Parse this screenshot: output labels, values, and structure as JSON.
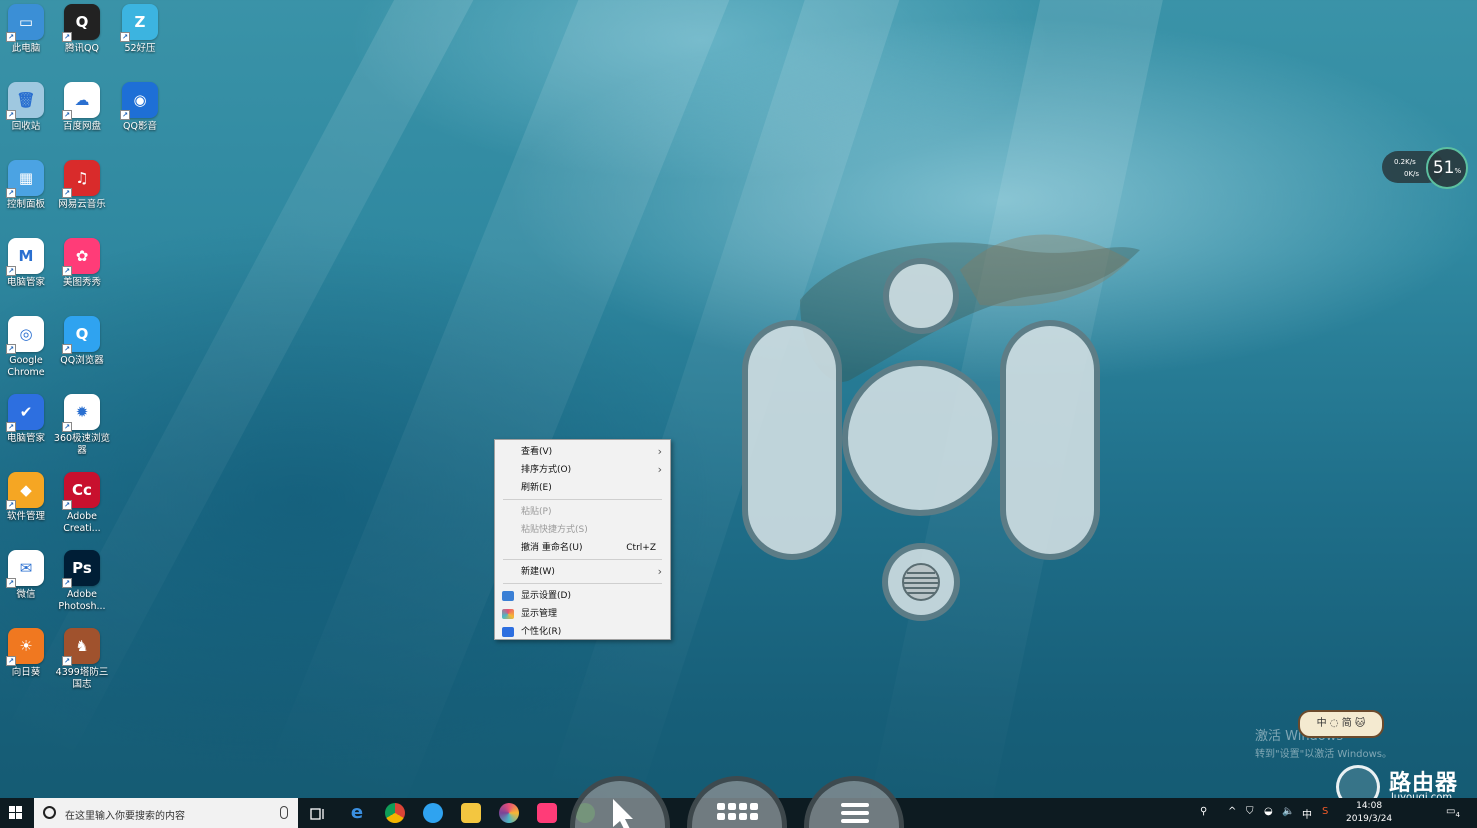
{
  "desktop": {
    "icons": [
      {
        "label": "此电脑",
        "color": "#3b8fd6",
        "glyph": "▭"
      },
      {
        "label": "腾讯QQ",
        "color": "#222222",
        "glyph": "Q"
      },
      {
        "label": "52好压",
        "color": "#3cb4e0",
        "glyph": "Z"
      },
      {
        "label": "回收站",
        "color": "#9fc8e0",
        "glyph": "🗑"
      },
      {
        "label": "百度网盘",
        "color": "#ffffff",
        "glyph": "☁"
      },
      {
        "label": "QQ影音",
        "color": "#1e6fd6",
        "glyph": "◉"
      },
      {
        "label": "控制面板",
        "color": "#4ba3e3",
        "glyph": "▦"
      },
      {
        "label": "网易云音乐",
        "color": "#d92b2b",
        "glyph": "♫"
      },
      {
        "label": "电脑管家",
        "color": "#ffffff",
        "glyph": "M"
      },
      {
        "label": "美图秀秀",
        "color": "#ff3c78",
        "glyph": "✿"
      },
      {
        "label": "Google Chrome",
        "color": "#ffffff",
        "glyph": "◎"
      },
      {
        "label": "QQ浏览器",
        "color": "#2fa3f0",
        "glyph": "Q"
      },
      {
        "label": "电脑管家",
        "color": "#2d6fe0",
        "glyph": "✔"
      },
      {
        "label": "360极速浏览器",
        "color": "#ffffff",
        "glyph": "✹"
      },
      {
        "label": "软件管理",
        "color": "#f5a623",
        "glyph": "◆"
      },
      {
        "label": "Adobe Creati...",
        "color": "#c8102e",
        "glyph": "Cc"
      },
      {
        "label": "微信",
        "color": "#ffffff",
        "glyph": "✉"
      },
      {
        "label": "Adobe Photosh...",
        "color": "#001e36",
        "glyph": "Ps"
      },
      {
        "label": "向日葵",
        "color": "#f07820",
        "glyph": "☀"
      },
      {
        "label": "4399塔防三国志",
        "color": "#a0522d",
        "glyph": "♞"
      }
    ]
  },
  "context_menu": {
    "items": [
      {
        "label": "查看(V)",
        "shortcut": "",
        "submenu": true,
        "disabled": false
      },
      {
        "label": "排序方式(O)",
        "shortcut": "",
        "submenu": true,
        "disabled": false
      },
      {
        "label": "刷新(E)",
        "shortcut": "",
        "submenu": false,
        "disabled": false
      },
      {
        "separator": true
      },
      {
        "label": "粘贴(P)",
        "shortcut": "",
        "submenu": false,
        "disabled": true
      },
      {
        "label": "粘贴快捷方式(S)",
        "shortcut": "",
        "submenu": false,
        "disabled": true
      },
      {
        "label": "撤消 重命名(U)",
        "shortcut": "Ctrl+Z",
        "submenu": false,
        "disabled": false
      },
      {
        "separator": true
      },
      {
        "label": "新建(W)",
        "shortcut": "",
        "submenu": true,
        "disabled": false
      },
      {
        "separator": true
      },
      {
        "label": "显示设置(D)",
        "shortcut": "",
        "submenu": false,
        "disabled": false,
        "icon": "display-icon"
      },
      {
        "label": "显示管理",
        "shortcut": "",
        "submenu": false,
        "disabled": false,
        "icon": "color-wheel-icon"
      },
      {
        "label": "个性化(R)",
        "shortcut": "",
        "submenu": false,
        "disabled": false,
        "icon": "personalize-icon"
      }
    ]
  },
  "net_meter": {
    "up": "0.2K/s",
    "down": "0K/s",
    "percent": "51",
    "unit": "%"
  },
  "watermark": {
    "line1": "激活 Windows",
    "line2": "转到\"设置\"以激活 Windows。"
  },
  "sticker": {
    "text": "中 ◌ 简 🐱"
  },
  "brand": {
    "name": "路由器",
    "url": "luyouqi.com"
  },
  "taskbar": {
    "search_placeholder": "在这里输入你要搜索的内容",
    "tray_ime": "中",
    "time": "14:08",
    "date": "2019/3/24",
    "notification_count": "4"
  }
}
